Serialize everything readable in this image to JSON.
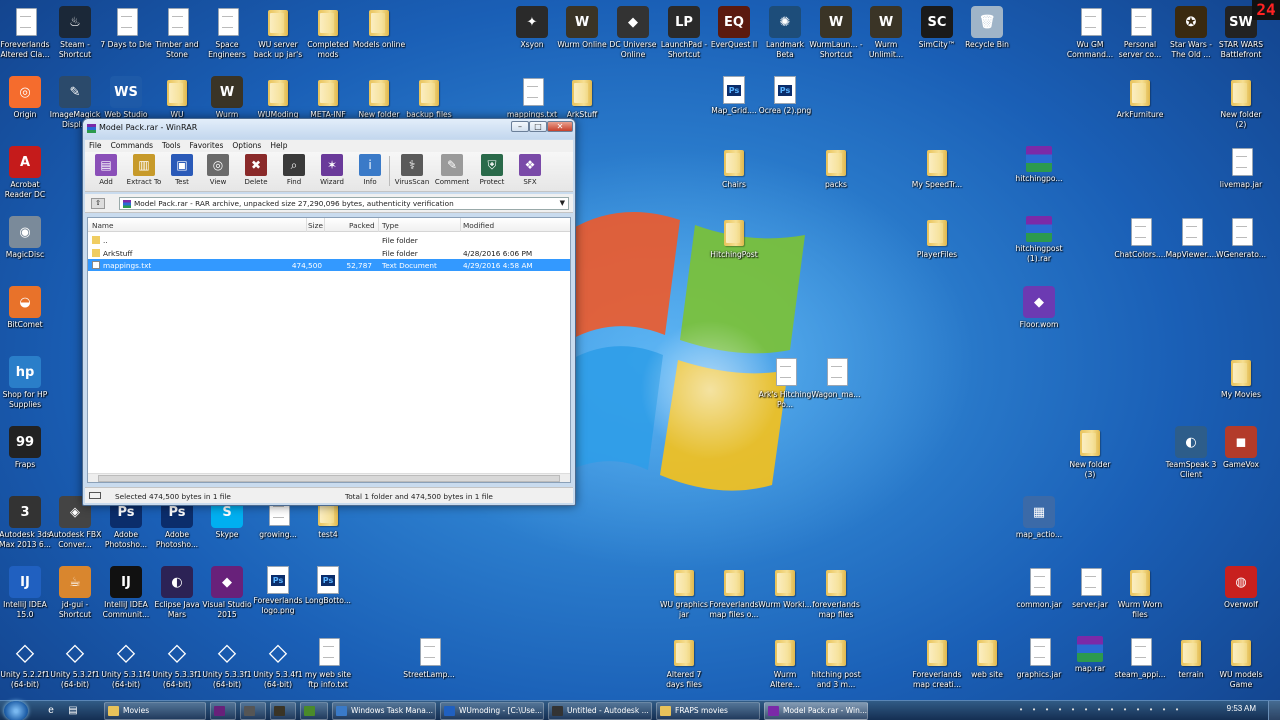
{
  "fps_counter": "24",
  "desktop_icons": [
    {
      "label": "Foreverlands Altered Cla...",
      "icon": "file-icon",
      "kind": "file"
    },
    {
      "label": "Steam - Shortcut",
      "icon": "steam-icon",
      "kind": "app",
      "color": "#1b2838",
      "glyph": "♨"
    },
    {
      "label": "7 Days to Die",
      "icon": "file-icon",
      "kind": "file"
    },
    {
      "label": "Timber and Stone",
      "icon": "file-icon",
      "kind": "file"
    },
    {
      "label": "Space Engineers",
      "icon": "file-icon",
      "kind": "file"
    },
    {
      "label": "WU server back up jar's",
      "icon": "folder-icon",
      "kind": "folder"
    },
    {
      "label": "Completed mods",
      "icon": "folder-icon",
      "kind": "folder"
    },
    {
      "label": "Models online",
      "icon": "folder-icon",
      "kind": "folder"
    },
    {
      "label": "Xsyon",
      "icon": "xsyon-icon",
      "kind": "app",
      "color": "#2a2a2a",
      "glyph": "✦"
    },
    {
      "label": "Wurm Online",
      "icon": "wurm-icon",
      "kind": "app",
      "color": "#3a3426",
      "glyph": "W"
    },
    {
      "label": "DC Universe Online",
      "icon": "dcuo-icon",
      "kind": "app",
      "color": "#333",
      "glyph": "◆"
    },
    {
      "label": "LaunchPad - Shortcut",
      "icon": "launchpad-icon",
      "kind": "app",
      "color": "#2a2a2a",
      "glyph": "LP"
    },
    {
      "label": "EverQuest II",
      "icon": "everquest-icon",
      "kind": "app",
      "color": "#5b1a0f",
      "glyph": "EQ"
    },
    {
      "label": "Landmark Beta",
      "icon": "landmark-icon",
      "kind": "app",
      "color": "#1d4d7a",
      "glyph": "✺"
    },
    {
      "label": "WurmLaun... - Shortcut",
      "icon": "wurm-icon",
      "kind": "app",
      "color": "#3a3426",
      "glyph": "W"
    },
    {
      "label": "Wurm Unlimit...",
      "icon": "wurm-icon",
      "kind": "app",
      "color": "#3a3426",
      "glyph": "W"
    },
    {
      "label": "SimCity™",
      "icon": "simcity-icon",
      "kind": "app",
      "color": "#1a1a1a",
      "glyph": "SC"
    },
    {
      "label": "Recycle Bin",
      "icon": "recycle-bin-icon",
      "kind": "app",
      "color": "#9fb4c8",
      "glyph": "🗑"
    },
    {
      "label": "Wu GM Command...",
      "icon": "file-icon",
      "kind": "file"
    },
    {
      "label": "Personal server co...",
      "icon": "file-icon",
      "kind": "file"
    },
    {
      "label": "Star Wars - The Old ...",
      "icon": "swtor-icon",
      "kind": "app",
      "color": "#3a2a10",
      "glyph": "✪"
    },
    {
      "label": "STAR WARS Battlefront",
      "icon": "battlefront-icon",
      "kind": "app",
      "color": "#222",
      "glyph": "SW"
    },
    {
      "label": "Origin",
      "icon": "origin-icon",
      "kind": "app",
      "color": "#f56c2d",
      "glyph": "◎"
    },
    {
      "label": "ImageMagick Displ...",
      "icon": "imagemagick-icon",
      "kind": "app",
      "color": "#2b4a6b",
      "glyph": "✎"
    },
    {
      "label": "Web Studio",
      "icon": "webstudio-icon",
      "kind": "app",
      "color": "#1e5aa8",
      "glyph": "WS"
    },
    {
      "label": "WU",
      "icon": "folder-icon",
      "kind": "folder"
    },
    {
      "label": "Wurm",
      "icon": "wurm-icon",
      "kind": "app",
      "color": "#3a3426",
      "glyph": "W"
    },
    {
      "label": "WUModing",
      "icon": "folder-icon",
      "kind": "folder"
    },
    {
      "label": "META-INF",
      "icon": "folder-icon",
      "kind": "folder"
    },
    {
      "label": "New folder",
      "icon": "folder-icon",
      "kind": "folder"
    },
    {
      "label": "backup files",
      "icon": "folder-icon",
      "kind": "folder"
    },
    {
      "label": "mappings.txt",
      "icon": "text-file-icon",
      "kind": "file"
    },
    {
      "label": "ArkStuff",
      "icon": "folder-icon",
      "kind": "folder"
    },
    {
      "label": "Map_Grid....",
      "icon": "ps-file-icon",
      "kind": "ps"
    },
    {
      "label": "Ocrea (2).png",
      "icon": "ps-file-icon",
      "kind": "ps"
    },
    {
      "label": "ArkFurniture",
      "icon": "folder-icon",
      "kind": "folder"
    },
    {
      "label": "New folder (2)",
      "icon": "folder-icon",
      "kind": "folder"
    },
    {
      "label": "Acrobat Reader DC",
      "icon": "acrobat-icon",
      "kind": "app",
      "color": "#c51b1b",
      "glyph": "A"
    },
    {
      "label": "Chairs",
      "icon": "folder-icon",
      "kind": "folder"
    },
    {
      "label": "packs",
      "icon": "folder-icon",
      "kind": "folder"
    },
    {
      "label": "My SpeedTr...",
      "icon": "folder-icon",
      "kind": "folder"
    },
    {
      "label": "hitchingpo...",
      "icon": "rar-icon",
      "kind": "rar"
    },
    {
      "label": "livemap.jar",
      "icon": "jar-file-icon",
      "kind": "file"
    },
    {
      "label": "MagicDisc",
      "icon": "magicdisc-icon",
      "kind": "app",
      "color": "#7a8a9a",
      "glyph": "◉"
    },
    {
      "label": "HitchingPost",
      "icon": "folder-icon",
      "kind": "folder"
    },
    {
      "label": "PlayerFiles",
      "icon": "folder-icon",
      "kind": "folder"
    },
    {
      "label": "hitchingpost (1).rar",
      "icon": "rar-icon",
      "kind": "rar"
    },
    {
      "label": "ChatColors....",
      "icon": "jar-file-icon",
      "kind": "file"
    },
    {
      "label": "MapViewer....",
      "icon": "jar-file-icon",
      "kind": "file"
    },
    {
      "label": "WGenerato...",
      "icon": "jar-file-icon",
      "kind": "file"
    },
    {
      "label": "BitComet",
      "icon": "bitcomet-icon",
      "kind": "app",
      "color": "#e8722a",
      "glyph": "◒"
    },
    {
      "label": "Floor.wom",
      "icon": "vs-file-icon",
      "kind": "app",
      "color": "#6c3ab2",
      "glyph": "◆"
    },
    {
      "label": "Shop for HP Supplies",
      "icon": "hp-icon",
      "kind": "app",
      "color": "#2a7ec9",
      "glyph": "hp"
    },
    {
      "label": "Ark's Hitching Po...",
      "icon": "file-icon",
      "kind": "file"
    },
    {
      "label": "Wagon_ma...",
      "icon": "file-icon",
      "kind": "file"
    },
    {
      "label": "My Movies",
      "icon": "folder-icon",
      "kind": "folder"
    },
    {
      "label": "Fraps",
      "icon": "fraps-icon",
      "kind": "app",
      "color": "#222",
      "glyph": "99"
    },
    {
      "label": "New folder (3)",
      "icon": "folder-icon",
      "kind": "folder"
    },
    {
      "label": "TeamSpeak 3 Client",
      "icon": "teamspeak-icon",
      "kind": "app",
      "color": "#2d5d8a",
      "glyph": "◐"
    },
    {
      "label": "GameVox",
      "icon": "gamevox-icon",
      "kind": "app",
      "color": "#b33b2a",
      "glyph": "◼"
    },
    {
      "label": "Autodesk 3ds Max 2013 6...",
      "icon": "3dsmax-icon",
      "kind": "app",
      "color": "#333",
      "glyph": "3"
    },
    {
      "label": "Autodesk FBX Conver...",
      "icon": "fbx-icon",
      "kind": "app",
      "color": "#444",
      "glyph": "◈"
    },
    {
      "label": "Adobe Photosho...",
      "icon": "photoshop-icon",
      "kind": "app",
      "color": "#0b2d6b",
      "glyph": "Ps"
    },
    {
      "label": "Adobe Photosho...",
      "icon": "photoshop-icon",
      "kind": "app",
      "color": "#0b2d6b",
      "glyph": "Ps"
    },
    {
      "label": "Skype",
      "icon": "skype-icon",
      "kind": "app",
      "color": "#00aff0",
      "glyph": "S"
    },
    {
      "label": "growing...",
      "icon": "file-icon",
      "kind": "file"
    },
    {
      "label": "test4",
      "icon": "folder-icon",
      "kind": "folder"
    },
    {
      "label": "map_actio...",
      "icon": "clut-file-icon",
      "kind": "app",
      "color": "#3b6aa8",
      "glyph": "▦"
    },
    {
      "label": "IntelliJ IDEA 15.0",
      "icon": "intellij-icon",
      "kind": "app",
      "color": "#2060c0",
      "glyph": "IJ"
    },
    {
      "label": "jd-gui - Shortcut",
      "icon": "jdgui-icon",
      "kind": "app",
      "color": "#d9862e",
      "glyph": "☕"
    },
    {
      "label": "IntelliJ IDEA Communit...",
      "icon": "intellij-icon",
      "kind": "app",
      "color": "#111",
      "glyph": "IJ"
    },
    {
      "label": "Eclipse Java Mars",
      "icon": "eclipse-icon",
      "kind": "app",
      "color": "#2c2255",
      "glyph": "◐"
    },
    {
      "label": "Visual Studio 2015",
      "icon": "visualstudio-icon",
      "kind": "app",
      "color": "#68217a",
      "glyph": "◆"
    },
    {
      "label": "Foreverlands logo.png",
      "icon": "ps-file-icon",
      "kind": "ps"
    },
    {
      "label": "LongBotto...",
      "icon": "ps-file-icon",
      "kind": "ps"
    },
    {
      "label": "WU graphics jar",
      "icon": "folder-icon",
      "kind": "folder"
    },
    {
      "label": "Foreverlands map files o...",
      "icon": "folder-icon",
      "kind": "folder"
    },
    {
      "label": "Wurm Worki...",
      "icon": "folder-icon",
      "kind": "folder"
    },
    {
      "label": "foreverlands map files",
      "icon": "folder-icon",
      "kind": "folder"
    },
    {
      "label": "common.jar",
      "icon": "jar-file-icon",
      "kind": "file"
    },
    {
      "label": "server.jar",
      "icon": "jar-file-icon",
      "kind": "file"
    },
    {
      "label": "Wurm Worn files",
      "icon": "folder-icon",
      "kind": "folder"
    },
    {
      "label": "Overwolf",
      "icon": "overwolf-icon",
      "kind": "app",
      "color": "#c8201e",
      "glyph": "◍"
    },
    {
      "label": "Unity 5.2.2f1 (64-bit)",
      "icon": "unity-icon",
      "kind": "unity"
    },
    {
      "label": "Unity 5.3.2f1 (64-bit)",
      "icon": "unity-icon",
      "kind": "unity"
    },
    {
      "label": "Unity 5.3.1f4 (64-bit)",
      "icon": "unity-icon",
      "kind": "unity"
    },
    {
      "label": "Unity 5.3.3f1 (64-bit)",
      "icon": "unity-icon",
      "kind": "unity"
    },
    {
      "label": "Unity 5.3.3f1 (64-bit)",
      "icon": "unity-icon",
      "kind": "unity"
    },
    {
      "label": "Unity 5.3.4f1 (64-bit)",
      "icon": "unity-icon",
      "kind": "unity"
    },
    {
      "label": "my web site ftp info.txt",
      "icon": "text-file-icon",
      "kind": "file"
    },
    {
      "label": "StreetLamp...",
      "icon": "file-icon",
      "kind": "file"
    },
    {
      "label": "Altered 7 days files",
      "icon": "folder-icon",
      "kind": "folder"
    },
    {
      "label": "Wurm Altere...",
      "icon": "folder-icon",
      "kind": "folder"
    },
    {
      "label": "hitching post and 3 m...",
      "icon": "folder-icon",
      "kind": "folder"
    },
    {
      "label": "Foreverlands map creati...",
      "icon": "folder-icon",
      "kind": "folder"
    },
    {
      "label": "web site",
      "icon": "folder-icon",
      "kind": "folder"
    },
    {
      "label": "graphics.jar",
      "icon": "jar-file-icon",
      "kind": "file"
    },
    {
      "label": "map.rar",
      "icon": "rar-icon",
      "kind": "rar"
    },
    {
      "label": "steam_appi...",
      "icon": "file-icon",
      "kind": "file"
    },
    {
      "label": "terrain",
      "icon": "folder-icon",
      "kind": "folder"
    },
    {
      "label": "WU models Game",
      "icon": "folder-icon",
      "kind": "folder"
    }
  ],
  "winrar": {
    "title": "Model Pack.rar - WinRAR",
    "menu": [
      "File",
      "Commands",
      "Tools",
      "Favorites",
      "Options",
      "Help"
    ],
    "toolbar": [
      {
        "label": "Add",
        "icon": "add-icon",
        "color": "#8a4fb8",
        "glyph": "▤"
      },
      {
        "label": "Extract To",
        "icon": "extract-to-icon",
        "color": "#c79a2a",
        "glyph": "▥"
      },
      {
        "label": "Test",
        "icon": "test-icon",
        "color": "#2a5ab8",
        "glyph": "▣"
      },
      {
        "label": "View",
        "icon": "view-icon",
        "color": "#6a6a6a",
        "glyph": "◎"
      },
      {
        "label": "Delete",
        "icon": "delete-icon",
        "color": "#8a2a2a",
        "glyph": "✖"
      },
      {
        "label": "Find",
        "icon": "find-icon",
        "color": "#3a3a3a",
        "glyph": "⌕"
      },
      {
        "label": "Wizard",
        "icon": "wizard-icon",
        "color": "#6a3a9a",
        "glyph": "✶"
      },
      {
        "label": "Info",
        "icon": "info-icon",
        "color": "#3a7ac8",
        "glyph": "i"
      },
      {
        "label": "VirusScan",
        "icon": "virusscan-icon",
        "color": "#5a5a5a",
        "glyph": "⚕"
      },
      {
        "label": "Comment",
        "icon": "comment-icon",
        "color": "#9a9a9a",
        "glyph": "✎"
      },
      {
        "label": "Protect",
        "icon": "protect-icon",
        "color": "#2a6a4a",
        "glyph": "⛨"
      },
      {
        "label": "SFX",
        "icon": "sfx-icon",
        "color": "#7a4aa8",
        "glyph": "❖"
      }
    ],
    "address": "Model Pack.rar - RAR archive, unpacked size 27,290,096 bytes, authenticity verification",
    "columns": {
      "name": "Name",
      "size": "Size",
      "packed": "Packed",
      "type": "Type",
      "modified": "Modified"
    },
    "rows": [
      {
        "name": "..",
        "size": "",
        "packed": "",
        "type": "File folder",
        "modified": "",
        "kind": "folder",
        "selected": false
      },
      {
        "name": "ArkStuff",
        "size": "",
        "packed": "",
        "type": "File folder",
        "modified": "4/28/2016 6:06 PM",
        "kind": "folder",
        "selected": false
      },
      {
        "name": "mappings.txt",
        "size": "474,500",
        "packed": "52,787",
        "type": "Text Document",
        "modified": "4/29/2016 4:58 AM",
        "kind": "doc",
        "selected": true
      }
    ],
    "status_left": "Selected 474,500 bytes in 1 file",
    "status_right": "Total 1 folder and 474,500 bytes in 1 file"
  },
  "taskbar": {
    "quick_launch": [
      {
        "icon": "ie-icon",
        "glyph": "e"
      },
      {
        "icon": "explorer-icon",
        "glyph": "▤"
      }
    ],
    "tasks": [
      {
        "label": "Movies",
        "icon": "folder-icon",
        "color": "#e8c25a",
        "active": false
      },
      {
        "label": "",
        "icon": "visualstudio-icon",
        "color": "#68217a",
        "active": false
      },
      {
        "label": "",
        "icon": "record-icon",
        "color": "#555",
        "active": false
      },
      {
        "label": "",
        "icon": "wurm-icon",
        "color": "#3a3426",
        "active": false
      },
      {
        "label": "",
        "icon": "chrome-icon",
        "color": "#4a8a2a",
        "active": false
      },
      {
        "label": "Windows Task Mana...",
        "icon": "taskmanager-icon",
        "color": "#3a7ac8",
        "active": false
      },
      {
        "label": "WUmoding - [C:\\Use...",
        "icon": "intellij-icon",
        "color": "#2060c0",
        "active": false
      },
      {
        "label": "Untitled - Autodesk ...",
        "icon": "3dsmax-icon",
        "color": "#333",
        "active": false
      },
      {
        "label": "FRAPS movies",
        "icon": "folder-icon",
        "color": "#e8c25a",
        "active": false
      },
      {
        "label": "Model Pack.rar - Win...",
        "icon": "rar-icon",
        "color": "#7b2aa8",
        "active": true
      }
    ],
    "tray_icons": [
      "network-icon",
      "shield-icon",
      "steam-tray-icon",
      "volume-icon",
      "usb-icon",
      "sync-icon",
      "chat-icon",
      "antivirus-icon",
      "flag-icon",
      "battery-icon",
      "bluetooth-icon",
      "update-icon",
      "speaker-icon"
    ],
    "clock": "9:53 AM"
  }
}
